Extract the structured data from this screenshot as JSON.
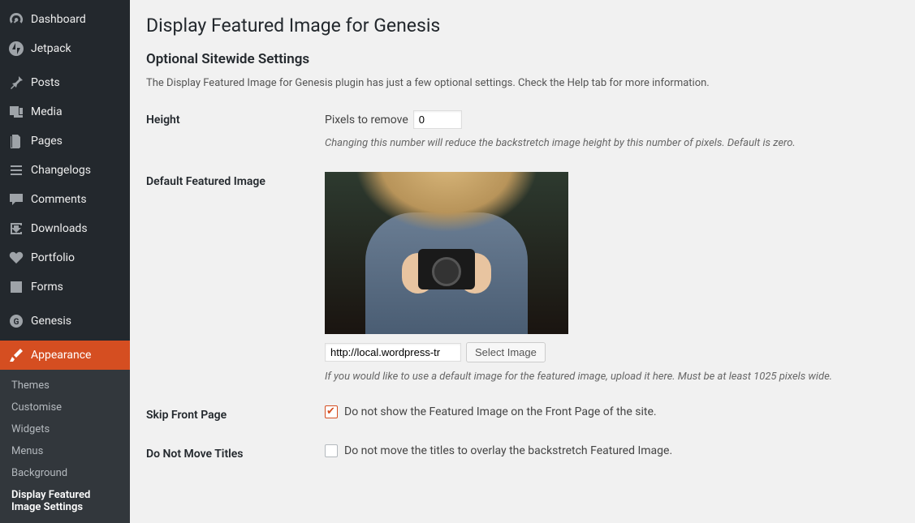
{
  "sidebar": {
    "items": [
      {
        "label": "Dashboard",
        "icon": "dashboard"
      },
      {
        "label": "Jetpack",
        "icon": "jetpack"
      },
      {
        "label": "Posts",
        "icon": "pin"
      },
      {
        "label": "Media",
        "icon": "media"
      },
      {
        "label": "Pages",
        "icon": "pages"
      },
      {
        "label": "Changelogs",
        "icon": "list"
      },
      {
        "label": "Comments",
        "icon": "comment"
      },
      {
        "label": "Downloads",
        "icon": "download"
      },
      {
        "label": "Portfolio",
        "icon": "heart"
      },
      {
        "label": "Forms",
        "icon": "form"
      },
      {
        "label": "Genesis",
        "icon": "genesis"
      },
      {
        "label": "Appearance",
        "icon": "brush",
        "active": true
      }
    ],
    "submenu": [
      {
        "label": "Themes"
      },
      {
        "label": "Customise"
      },
      {
        "label": "Widgets"
      },
      {
        "label": "Menus"
      },
      {
        "label": "Background"
      },
      {
        "label": "Display Featured Image Settings",
        "current": true
      }
    ]
  },
  "page": {
    "title": "Display Featured Image for Genesis",
    "section_title": "Optional Sitewide Settings",
    "intro": "The Display Featured Image for Genesis plugin has just a few optional settings. Check the Help tab for more information."
  },
  "fields": {
    "height": {
      "label": "Height",
      "prefix": "Pixels to remove",
      "value": "0",
      "help": "Changing this number will reduce the backstretch image height by this number of pixels. Default is zero."
    },
    "default_image": {
      "label": "Default Featured Image",
      "url_value": "http://local.wordpress-tr",
      "button": "Select Image",
      "help": "If you would like to use a default image for the featured image, upload it here. Must be at least 1025 pixels wide."
    },
    "skip_front": {
      "label": "Skip Front Page",
      "checked": true,
      "text": "Do not show the Featured Image on the Front Page of the site."
    },
    "no_move": {
      "label": "Do Not Move Titles",
      "checked": false,
      "text": "Do not move the titles to overlay the backstretch Featured Image."
    }
  }
}
